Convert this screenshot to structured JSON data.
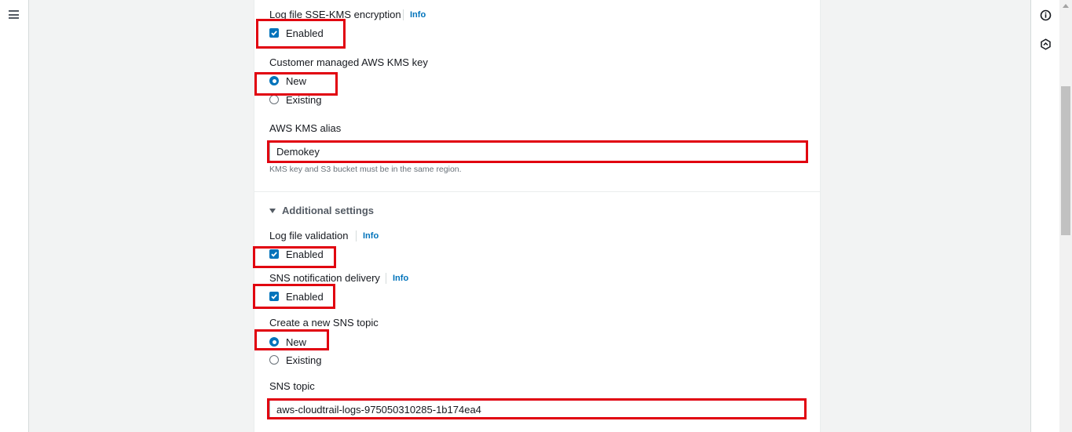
{
  "nav": {
    "menu_icon": "hamburger-menu-icon"
  },
  "right_rail": {
    "icons": [
      "info-circle-icon",
      "hexagon-settings-icon"
    ]
  },
  "encryption": {
    "label": "Log file SSE-KMS encryption",
    "info": "Info",
    "checkbox_label": "Enabled",
    "checked": true
  },
  "kms_key": {
    "label": "Customer managed AWS KMS key",
    "options": [
      "New",
      "Existing"
    ],
    "selected": "New"
  },
  "kms_alias": {
    "label": "AWS KMS alias",
    "value": "Demokey",
    "hint": "KMS key and S3 bucket must be in the same region."
  },
  "additional_settings": {
    "title": "Additional settings",
    "expanded": true
  },
  "log_validation": {
    "label": "Log file validation",
    "info": "Info",
    "checkbox_label": "Enabled",
    "checked": true
  },
  "sns_delivery": {
    "label": "SNS notification delivery",
    "info": "Info",
    "checkbox_label": "Enabled",
    "checked": true
  },
  "sns_topic_create": {
    "label": "Create a new SNS topic",
    "options": [
      "New",
      "Existing"
    ],
    "selected": "New"
  },
  "sns_topic": {
    "label": "SNS topic",
    "value": "aws-cloudtrail-logs-975050310285-1b174ea4"
  },
  "colors": {
    "accent": "#0073bb",
    "highlight": "#e1000f"
  }
}
